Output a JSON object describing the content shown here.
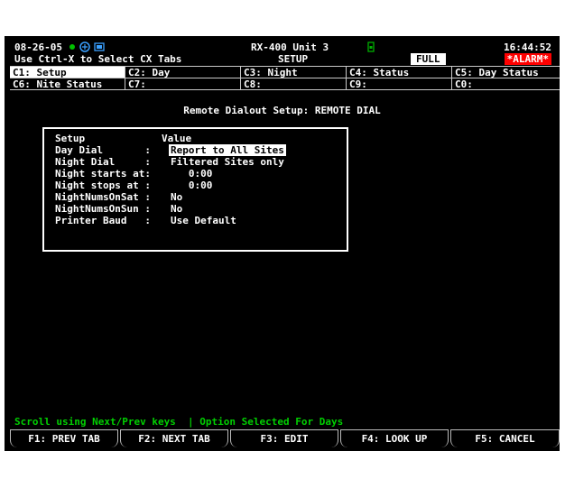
{
  "header": {
    "date": "08-26-05",
    "hint": "Use Ctrl-X to Select CX Tabs",
    "unit": "RX-400 Unit 3",
    "mode": "SETUP",
    "time": "16:44:52",
    "full_badge": "FULL",
    "alarm_badge": "*ALARM*",
    "status_dot_color": "#00c000",
    "network_icon": "network-icon",
    "key_icon": "key-icon"
  },
  "tabs": [
    {
      "label": "C1: Setup",
      "active": true
    },
    {
      "label": "C2: Day",
      "active": false
    },
    {
      "label": "C3: Night",
      "active": false
    },
    {
      "label": "C4: Status",
      "active": false
    },
    {
      "label": "C5: Day Status",
      "active": false
    },
    {
      "label": "C6: Nite Status",
      "active": false
    },
    {
      "label": "C7:",
      "active": false
    },
    {
      "label": "C8:",
      "active": false
    },
    {
      "label": "C9:",
      "active": false
    },
    {
      "label": "C0:",
      "active": false
    }
  ],
  "screen_title": "Remote Dialout Setup: REMOTE DIAL",
  "table": {
    "header_setup": "Setup",
    "header_value": "Value",
    "rows": [
      {
        "label": "Day Dial       :",
        "value": "Report to All Sites",
        "selected": true
      },
      {
        "label": "Night Dial     :",
        "value": "Filtered Sites only",
        "selected": false
      },
      {
        "label": "Night starts at:",
        "value": "   0:00",
        "selected": false
      },
      {
        "label": "Night stops at :",
        "value": "   0:00",
        "selected": false
      },
      {
        "label": "NightNumsOnSat :",
        "value": "No",
        "selected": false
      },
      {
        "label": "NightNumsOnSun :",
        "value": "No",
        "selected": false
      },
      {
        "label": "Printer Baud   :",
        "value": "Use Default",
        "selected": false
      }
    ]
  },
  "status_line": "Scroll using Next/Prev keys  | Option Selected For Days",
  "status_color": "#00d000",
  "function_keys": [
    "F1: PREV TAB",
    "F2: NEXT TAB",
    "F3: EDIT",
    "F4: LOOK UP",
    "F5: CANCEL"
  ]
}
